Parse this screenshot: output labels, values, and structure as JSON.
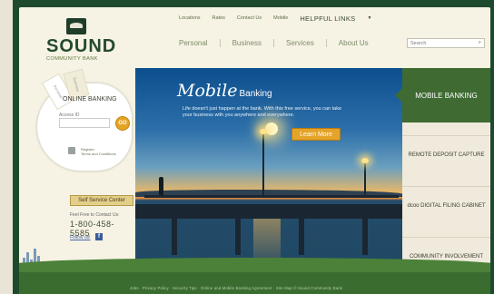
{
  "util_nav": {
    "items": [
      "Locations",
      "Rates",
      "Contact Us",
      "Mobile"
    ],
    "helpful": "HELPFUL LINKS",
    "caret": "▼"
  },
  "logo": {
    "name": "SOUND",
    "sub": "COMMUNITY BANK"
  },
  "main_nav": [
    "Personal",
    "Business",
    "Services",
    "About Us"
  ],
  "search": {
    "placeholder": "Search",
    "icon": "search-icon"
  },
  "login": {
    "title": "ONLINE BANKING",
    "account_label": "Access ID",
    "go": "GO",
    "register": "Register",
    "terms": "Terms and Conditions",
    "tab_a": "Personal",
    "tab_b": "Business"
  },
  "self_service": "Self Service Center",
  "contact": {
    "feel": "Feel Free to Contact Us:",
    "phone": "1-800-458-5585",
    "follow": "Follow us!",
    "fb_icon": "facebook-icon"
  },
  "hero": {
    "title_script": "Mobile",
    "title_plain": "Banking",
    "text": "Life doesn't just happen at the bank. With this free service, you can take your business with you anywhere and everywhere.",
    "cta": "Learn More"
  },
  "right_menu": [
    "MOBILE BANKING",
    "REMOTE DEPOSIT CAPTURE",
    "dcoo DIGITAL FILING CABINET",
    "COMMUNITY INVOLVEMENT"
  ],
  "footer": {
    "links": "Jobs · Privacy Policy · Security Tips · Online and Mobile Banking Agreement · Site Map   © Sound Community Bank"
  },
  "colors": {
    "primary_green": "#3f6b33",
    "accent_orange": "#e4a329",
    "frame_green": "#1d4a2d"
  }
}
